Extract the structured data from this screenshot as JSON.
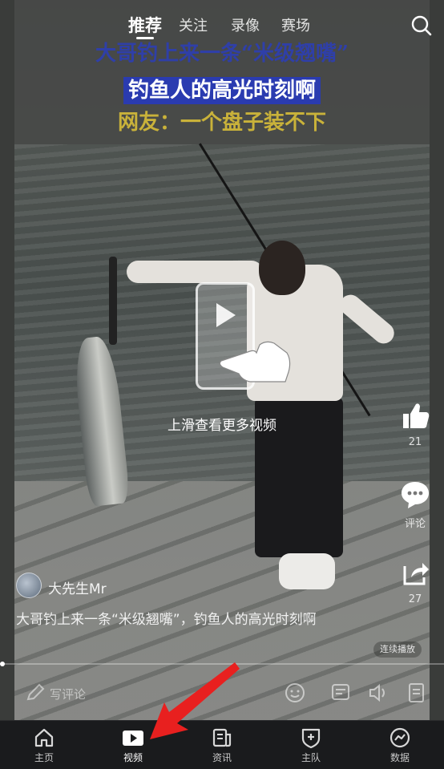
{
  "top_tabs": [
    {
      "label": "推荐",
      "active": true
    },
    {
      "label": "关注",
      "active": false
    },
    {
      "label": "录像",
      "active": false
    },
    {
      "label": "赛场",
      "active": false
    }
  ],
  "video": {
    "title_line1": "大哥钓上来一条“米级翘嘴”",
    "title_line2": "钓鱼人的高光时刻啊",
    "title_line3": "网友：一个盘子装不下"
  },
  "swipe_hint": "上滑查看更多视频",
  "side_actions": {
    "like_count": "21",
    "comment_label": "评论",
    "share_count": "27"
  },
  "author": {
    "name": "大先生Mr"
  },
  "description": "大哥钓上来一条“米级翘嘴”，钓鱼人的高光时刻啊",
  "autoplay_label": "连续播放",
  "comment_input": {
    "placeholder": "写评论"
  },
  "bottom_nav": [
    {
      "label": "主页",
      "icon": "home-icon",
      "active": false
    },
    {
      "label": "视频",
      "icon": "video-play-icon",
      "active": true
    },
    {
      "label": "资讯",
      "icon": "news-icon",
      "active": false
    },
    {
      "label": "主队",
      "icon": "team-shield-icon",
      "active": false
    },
    {
      "label": "数据",
      "icon": "data-chart-icon",
      "active": false
    }
  ],
  "colors": {
    "nav_background": "#1a1b1d",
    "annotation_arrow": "#e8201f",
    "title_blue": "#2a3bb0",
    "title_gold": "#c9b23a"
  }
}
